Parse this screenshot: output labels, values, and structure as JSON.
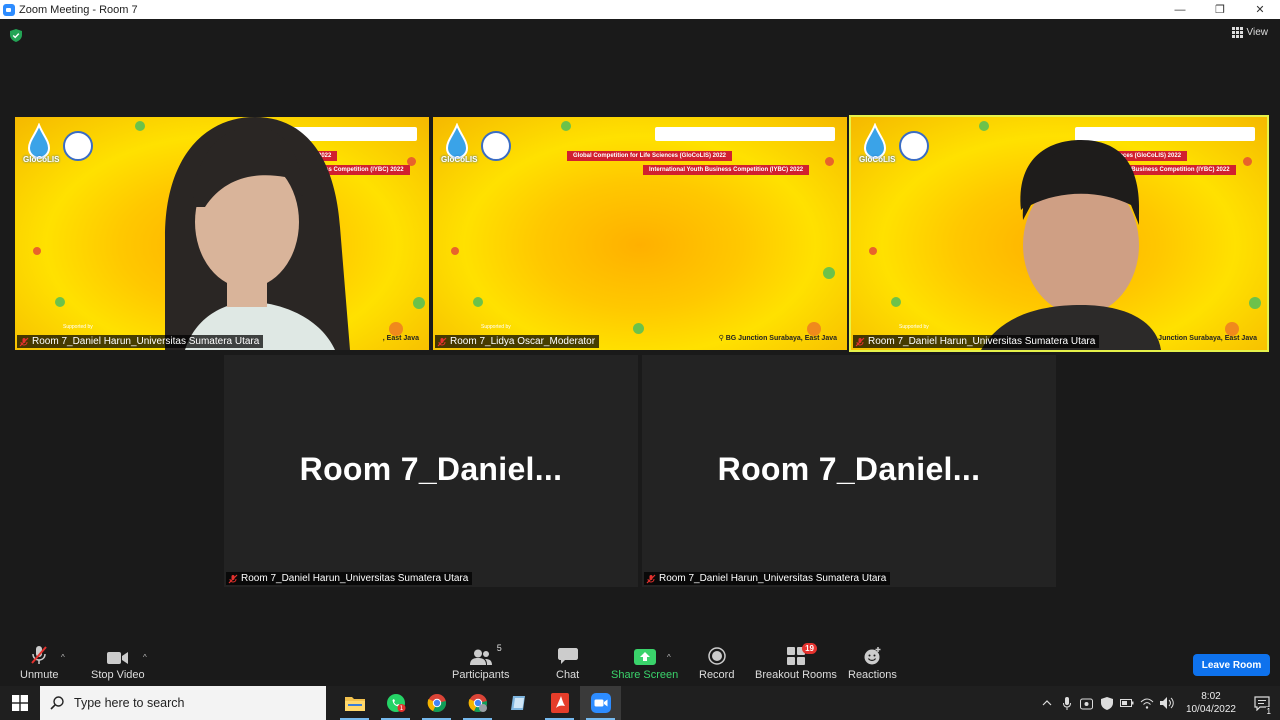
{
  "window": {
    "title": "Zoom Meeting - Room 7",
    "minimize_glyph": "—",
    "restore_glyph": "❐",
    "close_glyph": "✕"
  },
  "meeting": {
    "view_label": "View"
  },
  "video_tiles": [
    {
      "name": "Room 7_Daniel Harun_Universitas Sumatera Utara",
      "banner_line1": "GloCoLIS) 2022",
      "banner_line2": "Youth Business Competition (IYBC) 2022",
      "location": ", East Java",
      "supported": "Supported by",
      "logo_text": "GloCoLIS",
      "active": false
    },
    {
      "name": "Room 7_Lidya Oscar_Moderator",
      "banner_line1": "Global Competition for Life Sciences (GloCoLIS) 2022",
      "banner_line2": "International Youth Business Competition (IYBC) 2022",
      "location": "BG Junction Surabaya, East Java",
      "supported": "Supported by",
      "logo_text": "GloCoLIS",
      "active": false
    },
    {
      "name": "Room 7_Daniel Harun_Universitas Sumatera Utara",
      "banner_line1": "Sciences (GloCoLIS) 2022",
      "banner_line2": "Youth Business Competition (IYBC) 2022",
      "location": "Junction Surabaya, East Java",
      "supported": "Supported by",
      "logo_text": "GloCoLIS",
      "active": true
    }
  ],
  "blank_tiles": [
    {
      "display_name": "Room  7_Daniel...",
      "name": "Room 7_Daniel Harun_Universitas Sumatera Utara"
    },
    {
      "display_name": "Room  7_Daniel...",
      "name": "Room 7_Daniel Harun_Universitas Sumatera Utara"
    }
  ],
  "toolbar": {
    "unmute": "Unmute",
    "stop_video": "Stop Video",
    "participants": "Participants",
    "participants_count": "5",
    "chat": "Chat",
    "share_screen": "Share Screen",
    "record": "Record",
    "breakout_rooms": "Breakout Rooms",
    "breakout_badge": "19",
    "reactions": "Reactions",
    "leave": "Leave Room",
    "caret": "^"
  },
  "taskbar": {
    "search_placeholder": "Type here to search",
    "time": "8:02",
    "date": "10/04/2022",
    "notif_count": "1",
    "whatsapp_badge": "1"
  },
  "colors": {
    "accent_blue": "#0e72ed",
    "share_green": "#3ad36b",
    "badge_red": "#e5322e",
    "active_outline": "#e6f24a"
  }
}
